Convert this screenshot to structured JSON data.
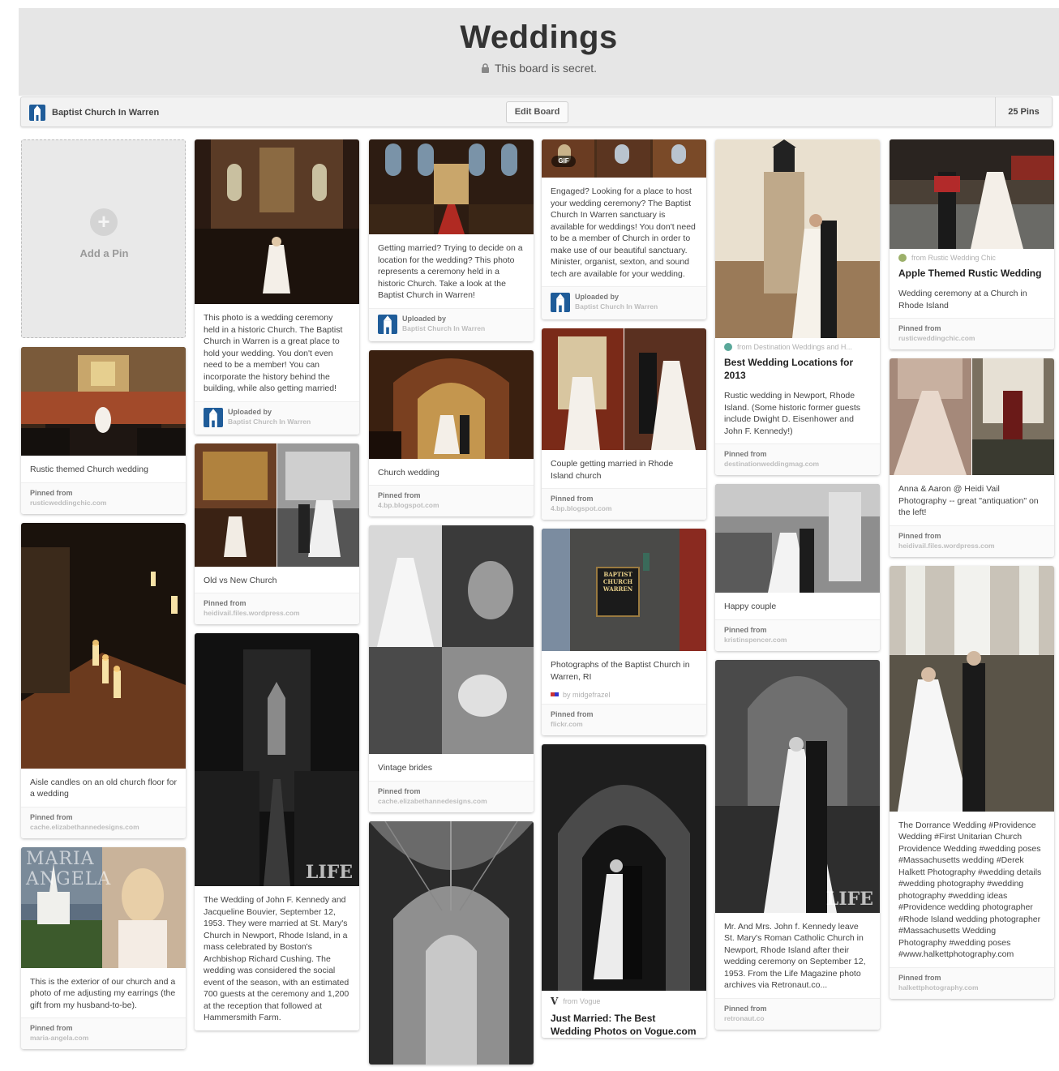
{
  "board": {
    "title": "Weddings",
    "secret_text": "This board is secret.",
    "owner_name": "Baptist Church In Warren",
    "edit_label": "Edit Board",
    "pin_count": "25 Pins"
  },
  "add_pin_label": "Add a Pin",
  "pins": {
    "c1p1": {
      "desc": "Rustic themed Church wedding",
      "foot_label": "Pinned from",
      "foot_domain": "rusticweddingchic.com"
    },
    "c1p2": {
      "desc": "Aisle candles on an old church floor for a wedding",
      "foot_label": "Pinned from",
      "foot_domain": "cache.elizabethannedesigns.com"
    },
    "c1p3": {
      "watermark": "MARIA ANGELA",
      "desc": "This is the exterior of our church and a photo of me adjusting my earrings (the gift from my husband-to-be).",
      "foot_label": "Pinned from",
      "foot_domain": "maria-angela.com"
    },
    "c2p1": {
      "desc": "This photo is a wedding ceremony held in a historic Church. The Baptist Church in Warren is a great place to hold your wedding. You don't even need to be a member! You can incorporate the history behind the building, while also getting married!",
      "foot_label": "Uploaded by",
      "foot_domain": "Baptist Church In Warren"
    },
    "c2p2": {
      "desc": "Old vs New Church",
      "foot_label": "Pinned from",
      "foot_domain": "heidivail.files.wordpress.com"
    },
    "c2p3": {
      "watermark": "LIFE",
      "desc": "The Wedding of John F. Kennedy and Jacqueline Bouvier, September 12, 1953. They were married at St. Mary's Church in Newport, Rhode Island, in a mass celebrated by Boston's Archbishop Richard Cushing. The wedding was considered the social event of the season, with an estimated 700 guests at the ceremony and 1,200 at the reception that followed at Hammersmith Farm."
    },
    "c3p1": {
      "desc": "Getting married? Trying to decide on a location for the wedding? This photo represents a ceremony held in a historic Church. Take a look at the Baptist Church in Warren!",
      "foot_label": "Uploaded by",
      "foot_domain": "Baptist Church In Warren"
    },
    "c3p2": {
      "desc": "Church wedding",
      "foot_label": "Pinned from",
      "foot_domain": "4.bp.blogspot.com"
    },
    "c3p3": {
      "desc": "Vintage brides",
      "foot_label": "Pinned from",
      "foot_domain": "cache.elizabethannedesigns.com"
    },
    "c4p1": {
      "badge": "GIF",
      "desc": "Engaged? Looking for a place to host your wedding ceremony? The Baptist Church In Warren sanctuary is available for weddings! You don't need to be a member of Church in order to make use of our beautiful sanctuary. Minister, organist, sexton, and sound tech are available for your wedding.",
      "foot_label": "Uploaded by",
      "foot_domain": "Baptist Church In Warren"
    },
    "c4p2": {
      "desc": "Couple getting married in Rhode Island church",
      "foot_label": "Pinned from",
      "foot_domain": "4.bp.blogspot.com"
    },
    "c4p3": {
      "sign": "BAPTIST CHURCH WARREN",
      "desc": "Photographs of the Baptist Church in Warren, RI",
      "via": "by midgefrazel",
      "foot_label": "Pinned from",
      "foot_domain": "flickr.com"
    },
    "c4p4": {
      "source": "from Vogue",
      "title": "Just Married: The Best Wedding Photos on Vogue.com"
    },
    "c5p1": {
      "source": "from Destination Weddings and H...",
      "title": "Best Wedding Locations for 2013",
      "desc": "Rustic wedding in Newport, Rhode Island. (Some historic former guests include Dwight D. Eisenhower and John F. Kennedy!)",
      "foot_label": "Pinned from",
      "foot_domain": "destinationweddingmag.com"
    },
    "c5p2": {
      "desc": "Happy couple",
      "foot_label": "Pinned from",
      "foot_domain": "kristinspencer.com"
    },
    "c5p3": {
      "watermark": "LIFE",
      "desc": "Mr. And Mrs. John f. Kennedy leave St. Mary's Roman Catholic Church in Newport, Rhode Island after their wedding ceremony on September 12, 1953. From the Life Magazine photo archives via Retronaut.co...",
      "foot_label": "Pinned from",
      "foot_domain": "retronaut.co"
    },
    "c6p1": {
      "source": "from Rustic Wedding Chic",
      "title": "Apple Themed Rustic Wedding",
      "desc": "Wedding ceremony at a Church in Rhode Island",
      "foot_label": "Pinned from",
      "foot_domain": "rusticweddingchic.com"
    },
    "c6p2": {
      "desc": "Anna & Aaron @ Heidi Vail Photography -- great \"antiquation\" on the left!",
      "foot_label": "Pinned from",
      "foot_domain": "heidivail.files.wordpress.com"
    },
    "c6p3": {
      "desc": "The Dorrance Wedding #Providence Wedding #First Unitarian Church Providence Wedding #wedding poses #Massachusetts wedding #Derek Halkett Photography #wedding details #wedding photography #wedding photography #wedding ideas #Providence wedding photographer #Rhode Island wedding photographer #Massachusetts Wedding Photography #wedding poses #www.halkettphotography.com",
      "foot_label": "Pinned from",
      "foot_domain": "halkettphotography.com"
    }
  },
  "colors": {
    "header_bg": "#e6e6e6",
    "avatar": "#1f5c99",
    "church_red": "#8e2a22",
    "wood": "#6b4123"
  }
}
